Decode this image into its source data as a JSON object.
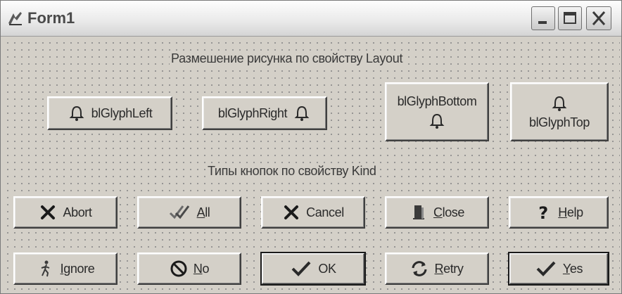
{
  "window": {
    "title": "Form1"
  },
  "labels": {
    "layout_caption": "Размешение рисунка по свойству Layout",
    "kind_caption": "Типы кнопок по свойству Kind"
  },
  "layout_buttons": [
    {
      "label": "blGlyphLeft"
    },
    {
      "label": "blGlyphRight"
    },
    {
      "label": "blGlyphBottom"
    },
    {
      "label": "blGlyphTop"
    }
  ],
  "kind_buttons": [
    {
      "label": "Abort"
    },
    {
      "label": "All"
    },
    {
      "label": "Cancel"
    },
    {
      "label": "Close"
    },
    {
      "label": "Help"
    },
    {
      "label": "Ignore"
    },
    {
      "label": "No"
    },
    {
      "label": "OK"
    },
    {
      "label": "Retry"
    },
    {
      "label": "Yes"
    }
  ],
  "icons": {
    "app": "delphi-form-icon",
    "minimize": "minimize-icon",
    "maximize": "maximize-icon",
    "close": "close-icon",
    "glyph": "bell-icon",
    "abort": "x-mark-icon",
    "all": "double-check-icon",
    "cancel": "x-mark-icon",
    "closeKind": "door-icon",
    "help": "question-mark-icon",
    "ignore": "running-man-icon",
    "no": "no-entry-icon",
    "ok": "check-icon",
    "retry": "retry-arrows-icon",
    "yes": "check-icon"
  },
  "colors": {
    "face": "#d4d0c8",
    "cancel_red": "#1a1a1a",
    "ok_green": "#3a3a3a"
  }
}
